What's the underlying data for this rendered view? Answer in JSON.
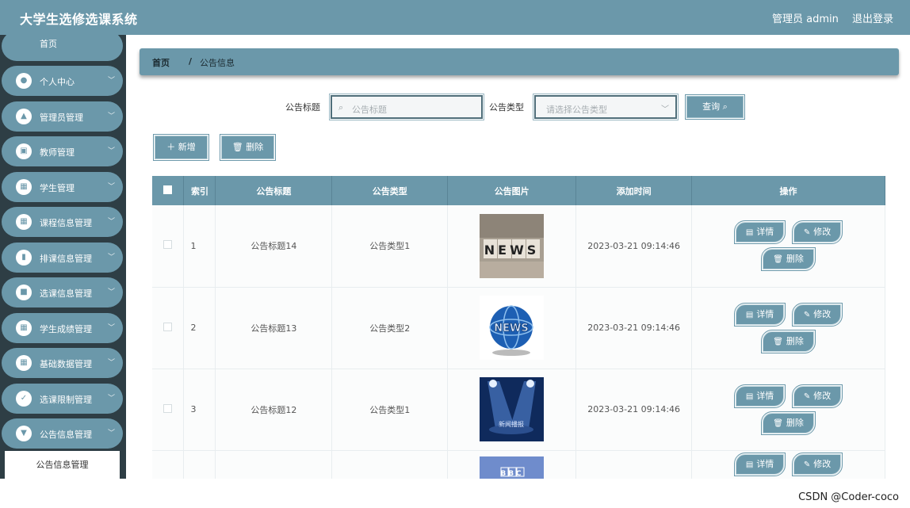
{
  "header": {
    "title": "大学生选修选课系统",
    "user": "管理员 admin",
    "logout": "退出登录"
  },
  "sidebar": {
    "home": "首页",
    "items": [
      {
        "label": "个人中心",
        "icon": "user-icon"
      },
      {
        "label": "管理员管理",
        "icon": "thumb-icon"
      },
      {
        "label": "教师管理",
        "icon": "chart-icon"
      },
      {
        "label": "学生管理",
        "icon": "grid-icon"
      },
      {
        "label": "课程信息管理",
        "icon": "grid-icon"
      },
      {
        "label": "排课信息管理",
        "icon": "bar-chart-icon"
      },
      {
        "label": "选课信息管理",
        "icon": "briefcase-icon"
      },
      {
        "label": "学生成绩管理",
        "icon": "grid-icon"
      },
      {
        "label": "基础数据管理",
        "icon": "grid-icon"
      },
      {
        "label": "选课限制管理",
        "icon": "clipboard-icon"
      },
      {
        "label": "公告信息管理",
        "icon": "podium-icon"
      }
    ],
    "sub_active": "公告信息管理"
  },
  "breadcrumb": {
    "home": "首页",
    "sep": "/",
    "current": "公告信息"
  },
  "filters": {
    "title_label": "公告标题",
    "title_placeholder": "公告标题",
    "type_label": "公告类型",
    "type_placeholder": "请选择公告类型",
    "search_button": "查询"
  },
  "actions": {
    "add": "新增",
    "delete": "删除"
  },
  "table": {
    "headers": [
      "索引",
      "公告标题",
      "公告类型",
      "公告图片",
      "添加时间",
      "操作"
    ],
    "rows": [
      {
        "index": "1",
        "title": "公告标题14",
        "type": "公告类型1",
        "image": "news-blocks",
        "time": "2023-03-21 09:14:46"
      },
      {
        "index": "2",
        "title": "公告标题13",
        "type": "公告类型2",
        "image": "news-globe",
        "time": "2023-03-21 09:14:46"
      },
      {
        "index": "3",
        "title": "公告标题12",
        "type": "公告类型1",
        "image": "news-stage",
        "time": "2023-03-21 09:14:46"
      },
      {
        "index": "",
        "title": "",
        "type": "",
        "image": "bbc",
        "time": ""
      }
    ],
    "ops": {
      "detail": "详情",
      "edit": "修改",
      "delete": "删除"
    }
  },
  "image_text": {
    "news": "NEWS",
    "stage": "新闻播报",
    "bbc": "BBC"
  },
  "watermark": "CSDN @Coder-coco",
  "colors": {
    "accent": "#6b98aa",
    "sidebar_bg": "#2e3e45"
  }
}
